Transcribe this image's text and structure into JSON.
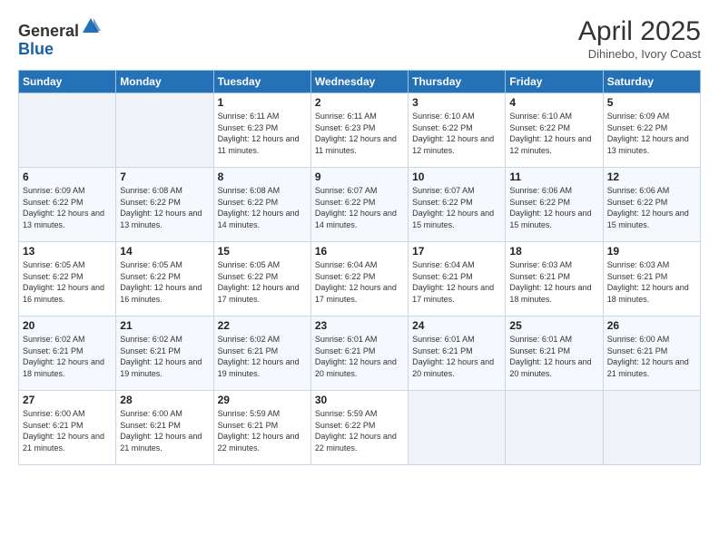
{
  "logo": {
    "general": "General",
    "blue": "Blue"
  },
  "title": "April 2025",
  "subtitle": "Dihinebo, Ivory Coast",
  "weekdays": [
    "Sunday",
    "Monday",
    "Tuesday",
    "Wednesday",
    "Thursday",
    "Friday",
    "Saturday"
  ],
  "weeks": [
    [
      {
        "num": "",
        "info": ""
      },
      {
        "num": "",
        "info": ""
      },
      {
        "num": "1",
        "info": "Sunrise: 6:11 AM\nSunset: 6:23 PM\nDaylight: 12 hours and 11 minutes."
      },
      {
        "num": "2",
        "info": "Sunrise: 6:11 AM\nSunset: 6:23 PM\nDaylight: 12 hours and 11 minutes."
      },
      {
        "num": "3",
        "info": "Sunrise: 6:10 AM\nSunset: 6:22 PM\nDaylight: 12 hours and 12 minutes."
      },
      {
        "num": "4",
        "info": "Sunrise: 6:10 AM\nSunset: 6:22 PM\nDaylight: 12 hours and 12 minutes."
      },
      {
        "num": "5",
        "info": "Sunrise: 6:09 AM\nSunset: 6:22 PM\nDaylight: 12 hours and 13 minutes."
      }
    ],
    [
      {
        "num": "6",
        "info": "Sunrise: 6:09 AM\nSunset: 6:22 PM\nDaylight: 12 hours and 13 minutes."
      },
      {
        "num": "7",
        "info": "Sunrise: 6:08 AM\nSunset: 6:22 PM\nDaylight: 12 hours and 13 minutes."
      },
      {
        "num": "8",
        "info": "Sunrise: 6:08 AM\nSunset: 6:22 PM\nDaylight: 12 hours and 14 minutes."
      },
      {
        "num": "9",
        "info": "Sunrise: 6:07 AM\nSunset: 6:22 PM\nDaylight: 12 hours and 14 minutes."
      },
      {
        "num": "10",
        "info": "Sunrise: 6:07 AM\nSunset: 6:22 PM\nDaylight: 12 hours and 15 minutes."
      },
      {
        "num": "11",
        "info": "Sunrise: 6:06 AM\nSunset: 6:22 PM\nDaylight: 12 hours and 15 minutes."
      },
      {
        "num": "12",
        "info": "Sunrise: 6:06 AM\nSunset: 6:22 PM\nDaylight: 12 hours and 15 minutes."
      }
    ],
    [
      {
        "num": "13",
        "info": "Sunrise: 6:05 AM\nSunset: 6:22 PM\nDaylight: 12 hours and 16 minutes."
      },
      {
        "num": "14",
        "info": "Sunrise: 6:05 AM\nSunset: 6:22 PM\nDaylight: 12 hours and 16 minutes."
      },
      {
        "num": "15",
        "info": "Sunrise: 6:05 AM\nSunset: 6:22 PM\nDaylight: 12 hours and 17 minutes."
      },
      {
        "num": "16",
        "info": "Sunrise: 6:04 AM\nSunset: 6:22 PM\nDaylight: 12 hours and 17 minutes."
      },
      {
        "num": "17",
        "info": "Sunrise: 6:04 AM\nSunset: 6:21 PM\nDaylight: 12 hours and 17 minutes."
      },
      {
        "num": "18",
        "info": "Sunrise: 6:03 AM\nSunset: 6:21 PM\nDaylight: 12 hours and 18 minutes."
      },
      {
        "num": "19",
        "info": "Sunrise: 6:03 AM\nSunset: 6:21 PM\nDaylight: 12 hours and 18 minutes."
      }
    ],
    [
      {
        "num": "20",
        "info": "Sunrise: 6:02 AM\nSunset: 6:21 PM\nDaylight: 12 hours and 18 minutes."
      },
      {
        "num": "21",
        "info": "Sunrise: 6:02 AM\nSunset: 6:21 PM\nDaylight: 12 hours and 19 minutes."
      },
      {
        "num": "22",
        "info": "Sunrise: 6:02 AM\nSunset: 6:21 PM\nDaylight: 12 hours and 19 minutes."
      },
      {
        "num": "23",
        "info": "Sunrise: 6:01 AM\nSunset: 6:21 PM\nDaylight: 12 hours and 20 minutes."
      },
      {
        "num": "24",
        "info": "Sunrise: 6:01 AM\nSunset: 6:21 PM\nDaylight: 12 hours and 20 minutes."
      },
      {
        "num": "25",
        "info": "Sunrise: 6:01 AM\nSunset: 6:21 PM\nDaylight: 12 hours and 20 minutes."
      },
      {
        "num": "26",
        "info": "Sunrise: 6:00 AM\nSunset: 6:21 PM\nDaylight: 12 hours and 21 minutes."
      }
    ],
    [
      {
        "num": "27",
        "info": "Sunrise: 6:00 AM\nSunset: 6:21 PM\nDaylight: 12 hours and 21 minutes."
      },
      {
        "num": "28",
        "info": "Sunrise: 6:00 AM\nSunset: 6:21 PM\nDaylight: 12 hours and 21 minutes."
      },
      {
        "num": "29",
        "info": "Sunrise: 5:59 AM\nSunset: 6:21 PM\nDaylight: 12 hours and 22 minutes."
      },
      {
        "num": "30",
        "info": "Sunrise: 5:59 AM\nSunset: 6:22 PM\nDaylight: 12 hours and 22 minutes."
      },
      {
        "num": "",
        "info": ""
      },
      {
        "num": "",
        "info": ""
      },
      {
        "num": "",
        "info": ""
      }
    ]
  ]
}
